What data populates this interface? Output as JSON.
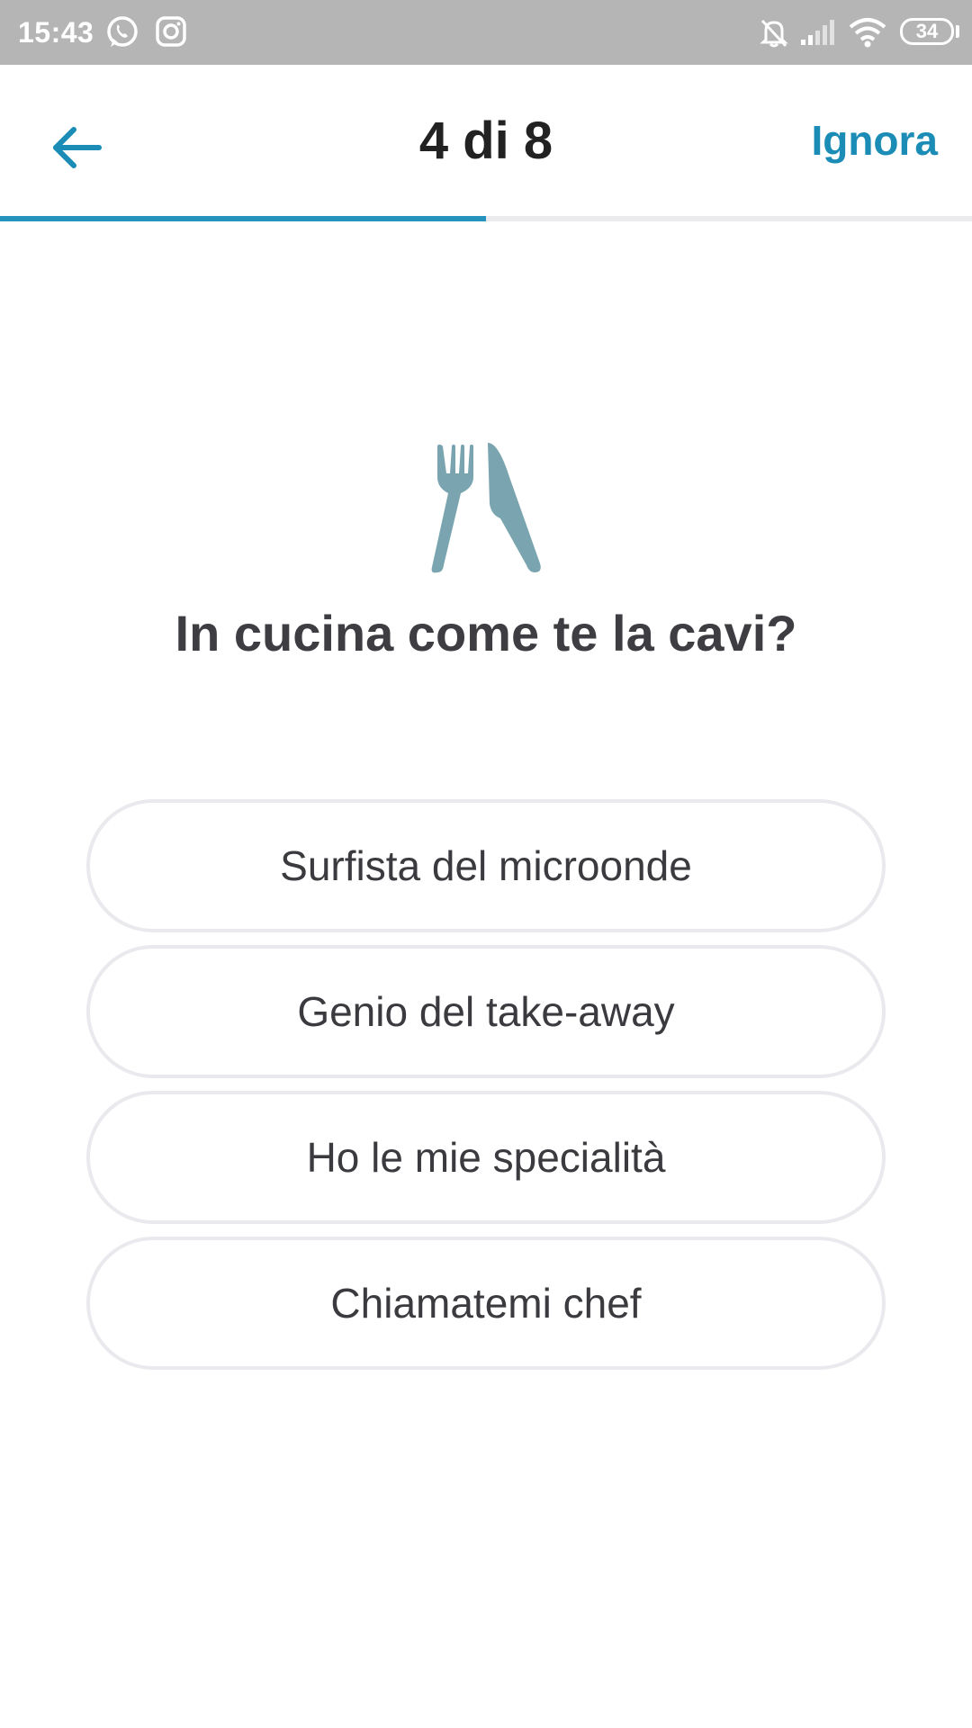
{
  "status_bar": {
    "time": "15:43",
    "battery": "34",
    "icons": [
      "whatsapp-icon",
      "instagram-icon",
      "notifications-off-icon",
      "signal-icon",
      "wifi-icon",
      "battery-icon"
    ]
  },
  "header": {
    "back_icon": "arrow-left-icon",
    "step_label": "4 di 8",
    "skip_label": "Ignora",
    "progress": 0.5
  },
  "question": {
    "icon": "fork-knife-icon",
    "text": "In cucina come te la cavi?"
  },
  "options": [
    {
      "label": "Surfista del microonde"
    },
    {
      "label": "Genio del take-away"
    },
    {
      "label": "Ho le mie specialità"
    },
    {
      "label": "Chiamatemi chef"
    }
  ],
  "colors": {
    "accent": "#1a8cb5",
    "icon": "#7aa5b0",
    "status_bar": "#b5b5b5",
    "option_border": "#e9e9ee",
    "text": "#3a3a3f"
  }
}
